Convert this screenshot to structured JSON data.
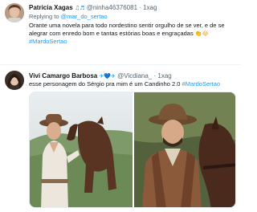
{
  "tweet1": {
    "name": "Patricia Xagas",
    "name_emoji": "♫♬",
    "handle": "@ninha46376081",
    "dot": "·",
    "time": "1xag",
    "reply_prefix": "Replying to",
    "reply_handle": "@mar_do_sertao",
    "text_line1": "Orante uma novela para todo nordestino sentir orgulho de se ver, e de se",
    "text_line2": "alegrar com  enredo bom e tantas estórias boas e engraçadas",
    "text_emoji": "👏😂",
    "hashtag": "#MardoSertao"
  },
  "tweet2": {
    "name": "Vivi Camargo Barbosa",
    "name_emojis": "✈💙✈",
    "handle": "@Vicdiana_",
    "dot": "·",
    "time": "1xag",
    "text": "esse personagem do Sérgio pra mim é um Candinho 2.0",
    "hashtag": "#MardoSertao"
  },
  "colors": {
    "link": "#1d9bf0",
    "text": "#0f1419",
    "muted": "#536471",
    "divider": "#eff3f4"
  }
}
